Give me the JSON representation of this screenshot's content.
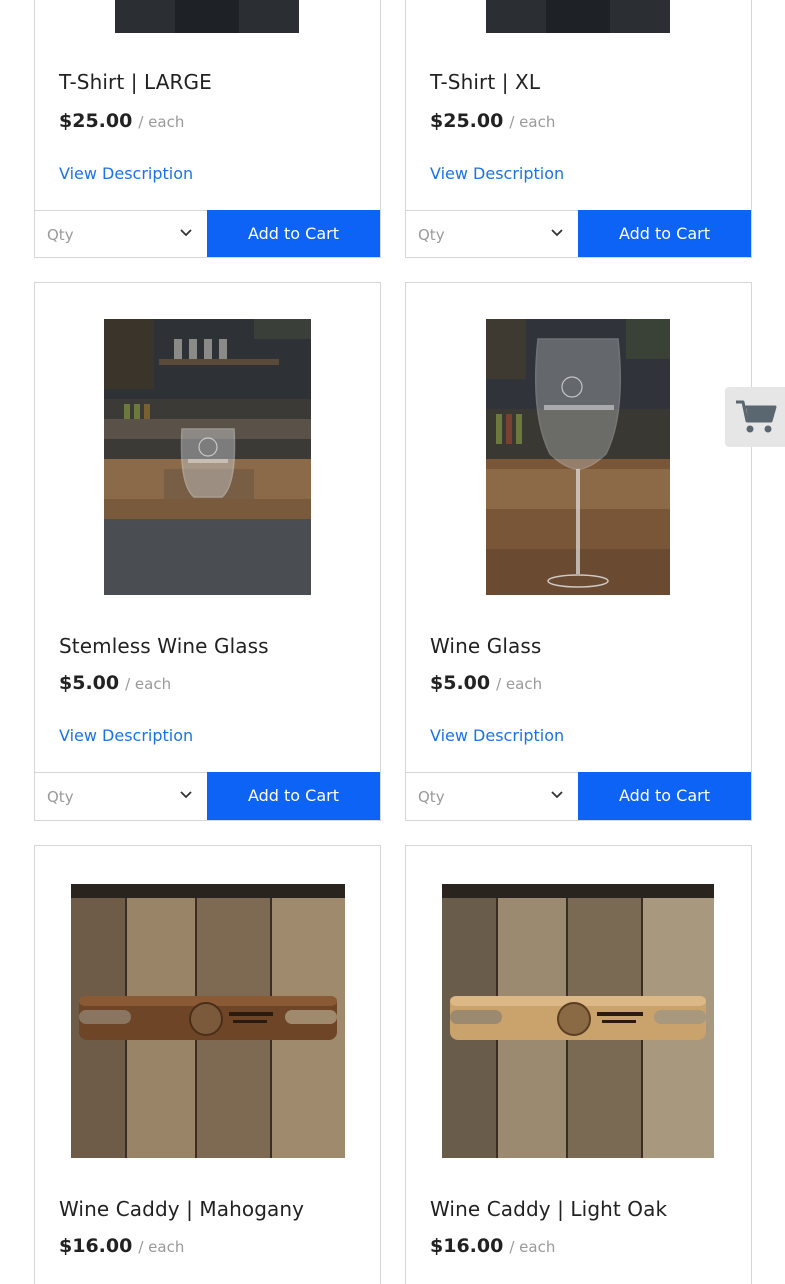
{
  "products": [
    {
      "name": "T-Shirt | LARGE",
      "price": "$25.00",
      "unit": "/ each",
      "link": "View Description",
      "qty_placeholder": "Qty",
      "cart_label": "Add to Cart"
    },
    {
      "name": "T-Shirt | XL",
      "price": "$25.00",
      "unit": "/ each",
      "link": "View Description",
      "qty_placeholder": "Qty",
      "cart_label": "Add to Cart"
    },
    {
      "name": "Stemless Wine Glass",
      "price": "$5.00",
      "unit": "/ each",
      "link": "View Description",
      "qty_placeholder": "Qty",
      "cart_label": "Add to Cart"
    },
    {
      "name": "Wine Glass",
      "price": "$5.00",
      "unit": "/ each",
      "link": "View Description",
      "qty_placeholder": "Qty",
      "cart_label": "Add to Cart"
    },
    {
      "name": "Wine Caddy | Mahogany",
      "price": "$16.00",
      "unit": "/ each"
    },
    {
      "name": "Wine Caddy | Light Oak",
      "price": "$16.00",
      "unit": "/ each"
    }
  ],
  "images": [
    {
      "icon": "tshirt-photo"
    },
    {
      "icon": "tshirt-photo"
    },
    {
      "icon": "stemless-glass-photo"
    },
    {
      "icon": "wine-glass-photo"
    },
    {
      "icon": "wine-caddy-photo"
    },
    {
      "icon": "wine-caddy-photo"
    }
  ],
  "cart_widget": {
    "icon": "shopping-cart-icon"
  },
  "colors": {
    "accent": "#0d63f5",
    "link": "#1a73e8",
    "muted": "#9a9a9a",
    "border": "#d6d6d6"
  }
}
